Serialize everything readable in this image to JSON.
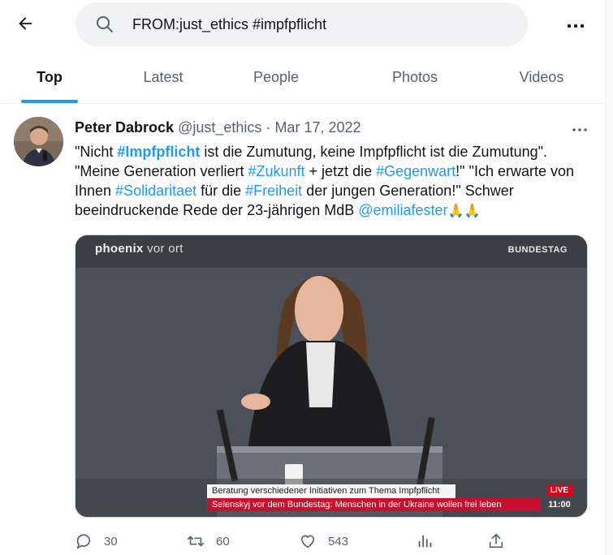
{
  "search": {
    "query": "FROM:just_ethics #impfpflicht"
  },
  "tabs": [
    {
      "label": "Top",
      "active": true
    },
    {
      "label": "Latest",
      "active": false
    },
    {
      "label": "People",
      "active": false
    },
    {
      "label": "Photos",
      "active": false
    },
    {
      "label": "Videos",
      "active": false
    }
  ],
  "tweet": {
    "author_name": "Peter Dabrock",
    "author_handle": "@just_ethics",
    "separator": "·",
    "date": "Mar 17, 2022",
    "text_parts": [
      {
        "t": "\"Nicht ",
        "type": "text"
      },
      {
        "t": "#Impfpflicht",
        "type": "tag-bold"
      },
      {
        "t": " ist die Zumutung, keine Impfpflicht ist die Zumutung\". \"Meine Generation verliert ",
        "type": "text"
      },
      {
        "t": "#Zukunft",
        "type": "tag"
      },
      {
        "t": " + jetzt die ",
        "type": "text"
      },
      {
        "t": "#Gegenwart",
        "type": "tag"
      },
      {
        "t": "!\" \"Ich erwarte von Ihnen ",
        "type": "text"
      },
      {
        "t": "#Solidaritaet",
        "type": "tag"
      },
      {
        "t": " für die ",
        "type": "text"
      },
      {
        "t": "#Freiheit",
        "type": "tag"
      },
      {
        "t": " der jungen Generation!\" Schwer beeindruckende Rede der 23-jährigen MdB ",
        "type": "text"
      },
      {
        "t": "@emiliafester",
        "type": "tag"
      },
      {
        "t": "🙏🙏",
        "type": "emoji"
      }
    ],
    "media": {
      "brand_bold": "phoenix",
      "brand_light": " vor ort",
      "channel_label": "BUNDESTAG",
      "caption_line1": "Beratung verschiedener Initiativen zum Thema Impfpflicht",
      "caption_line2": "Selenskyj vor dem Bundestag: Menschen in der Ukraine wollen frei leben",
      "live_label": "LIVE",
      "time": "11:00"
    },
    "actions": {
      "replies": "30",
      "retweets": "60",
      "likes": "543"
    }
  },
  "colors": {
    "accent": "#1d9bf0",
    "text_primary": "#0f1419",
    "text_secondary": "#536471",
    "search_bg": "#eff3f4"
  }
}
